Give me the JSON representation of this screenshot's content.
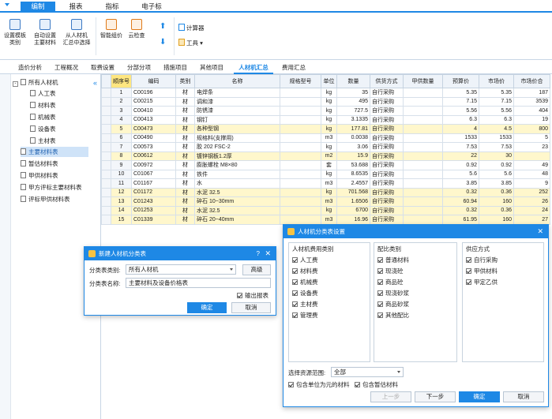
{
  "menubar": {
    "items": [
      "编制",
      "报表",
      "指标",
      "电子标"
    ],
    "active": 0
  },
  "ribbon": {
    "buttons": [
      {
        "label": "设置模板\n类别",
        "icon": "template-icon"
      },
      {
        "label": "自动设置\n主要材料",
        "icon": "auto-set-icon"
      },
      {
        "label": "从人材机\n汇总中选择",
        "icon": "select-summary-icon"
      },
      {
        "label": "智能组价",
        "icon": "smart-price-icon"
      },
      {
        "label": "云检查",
        "icon": "cloud-check-icon"
      }
    ],
    "calculator": "计算器",
    "tools": "工具"
  },
  "tabs": [
    "造价分析",
    "工程概况",
    "取费设置",
    "分部分项",
    "措施项目",
    "其他项目",
    "人材机汇总",
    "费用汇总"
  ],
  "active_tab": 6,
  "tree": {
    "root": "所有人材机",
    "items": [
      "人工表",
      "材料表",
      "机械表",
      "设备表",
      "主材表"
    ],
    "extra": [
      "主要材料表",
      "暂估材料表",
      "甲供材料表",
      "甲方评标主要材料表",
      "评标甲供材料表"
    ]
  },
  "table": {
    "headers": [
      "编码",
      "类别",
      "名称",
      "规格型号",
      "单位",
      "数量",
      "供货方式",
      "甲供数量",
      "预算价",
      "市场价",
      "市场价合"
    ],
    "corner": "顺序号",
    "rows": [
      {
        "n": "1",
        "code": "C00196",
        "cat": "材",
        "name": "电焊条",
        "spec": "",
        "unit": "kg",
        "qty": "35",
        "supply": "自行采购",
        "jg": "",
        "budget": "5.35",
        "market": "5.35",
        "total": "187",
        "hl": false
      },
      {
        "n": "2",
        "code": "C00215",
        "cat": "材",
        "name": "调和漆",
        "spec": "",
        "unit": "kg",
        "qty": "495",
        "supply": "自行采购",
        "jg": "",
        "budget": "7.15",
        "market": "7.15",
        "total": "3539",
        "hl": false
      },
      {
        "n": "3",
        "code": "C00410",
        "cat": "材",
        "name": "防锈漆",
        "spec": "",
        "unit": "kg",
        "qty": "727.5",
        "supply": "自行采购",
        "jg": "",
        "budget": "5.56",
        "market": "5.56",
        "total": "404",
        "hl": false
      },
      {
        "n": "4",
        "code": "C00413",
        "cat": "材",
        "name": "钢钉",
        "spec": "",
        "unit": "kg",
        "qty": "3.1335",
        "supply": "自行采购",
        "jg": "",
        "budget": "6.3",
        "market": "6.3",
        "total": "19",
        "hl": false
      },
      {
        "n": "5",
        "code": "C00473",
        "cat": "材",
        "name": "各种型钢",
        "spec": "",
        "unit": "kg",
        "qty": "177.81",
        "supply": "自行采购",
        "jg": "",
        "budget": "4",
        "market": "4.5",
        "total": "800",
        "hl": true
      },
      {
        "n": "6",
        "code": "C00490",
        "cat": "材",
        "name": "规格料(支撑用)",
        "spec": "",
        "unit": "m3",
        "qty": "0.0038",
        "supply": "自行采购",
        "jg": "",
        "budget": "1533",
        "market": "1533",
        "total": "5",
        "hl": false
      },
      {
        "n": "7",
        "code": "C00573",
        "cat": "材",
        "name": "胶 202 FSC-2",
        "spec": "",
        "unit": "kg",
        "qty": "3.06",
        "supply": "自行采购",
        "jg": "",
        "budget": "7.53",
        "market": "7.53",
        "total": "23",
        "hl": false
      },
      {
        "n": "8",
        "code": "C00612",
        "cat": "材",
        "name": "镀锌钢板1.2厚",
        "spec": "",
        "unit": "m2",
        "qty": "15.9",
        "supply": "自行采购",
        "jg": "",
        "budget": "22",
        "market": "30",
        "total": "",
        "hl": true
      },
      {
        "n": "9",
        "code": "C00972",
        "cat": "材",
        "name": "膨胀螺栓 M8×80",
        "spec": "",
        "unit": "套",
        "qty": "53.688",
        "supply": "自行采购",
        "jg": "",
        "budget": "0.92",
        "market": "0.92",
        "total": "49",
        "hl": false
      },
      {
        "n": "10",
        "code": "C01067",
        "cat": "材",
        "name": "铁件",
        "spec": "",
        "unit": "kg",
        "qty": "8.6535",
        "supply": "自行采购",
        "jg": "",
        "budget": "5.6",
        "market": "5.6",
        "total": "48",
        "hl": false
      },
      {
        "n": "11",
        "code": "C01167",
        "cat": "材",
        "name": "水",
        "spec": "",
        "unit": "m3",
        "qty": "2.4557",
        "supply": "自行采购",
        "jg": "",
        "budget": "3.85",
        "market": "3.85",
        "total": "9",
        "hl": false
      },
      {
        "n": "12",
        "code": "C01172",
        "cat": "材",
        "name": "水泥 32.5",
        "spec": "",
        "unit": "kg",
        "qty": "701.568",
        "supply": "自行采购",
        "jg": "",
        "budget": "0.32",
        "market": "0.36",
        "total": "252",
        "hl": true
      },
      {
        "n": "13",
        "code": "C01243",
        "cat": "材",
        "name": "碎石 10~30mm",
        "spec": "",
        "unit": "m3",
        "qty": "1.6506",
        "supply": "自行采购",
        "jg": "",
        "budget": "60.94",
        "market": "160",
        "total": "26",
        "hl": true
      },
      {
        "n": "14",
        "code": "C01253",
        "cat": "材",
        "name": "水泥 32.5",
        "spec": "",
        "unit": "kg",
        "qty": "6700",
        "supply": "自行采购",
        "jg": "",
        "budget": "0.32",
        "market": "0.36",
        "total": "24",
        "hl": true
      },
      {
        "n": "15",
        "code": "C01339",
        "cat": "材",
        "name": "碎石 20~40mm",
        "spec": "",
        "unit": "m3",
        "qty": "16.96",
        "supply": "自行采购",
        "jg": "",
        "budget": "61.95",
        "market": "160",
        "total": "27",
        "hl": true
      }
    ]
  },
  "dlg_new": {
    "title": "新建人材机分类表",
    "help": "?",
    "close": "✕",
    "category_label": "分类表类别:",
    "category_value": "所有人材机",
    "advanced": "高级",
    "name_label": "分类表名称:",
    "name_value": "主要材料及设备价格表",
    "output_label": "输出报表",
    "ok": "确定",
    "cancel": "取消"
  },
  "dlg_set": {
    "title": "人材机分类表设置",
    "close": "✕",
    "g1_title": "人材机费用类别",
    "g1_items": [
      "人工费",
      "材料费",
      "机械费",
      "设备费",
      "主材费",
      "管理费"
    ],
    "g2_title": "配比类别",
    "g2_items": [
      "普通材料",
      "现浇砼",
      "商品砼",
      "现浇砂浆",
      "商品砂浆",
      "其他配比"
    ],
    "g3_title": "供应方式",
    "g3_items": [
      "自行采购",
      "甲供材料",
      "甲定乙供"
    ],
    "range_label": "选择资源范围:",
    "range_value": "全部",
    "opt1": "包含单位为元的材料",
    "opt2": "包含暂估材料",
    "prev": "上一步",
    "next": "下一步",
    "ok": "确定",
    "cancel": "取消"
  }
}
